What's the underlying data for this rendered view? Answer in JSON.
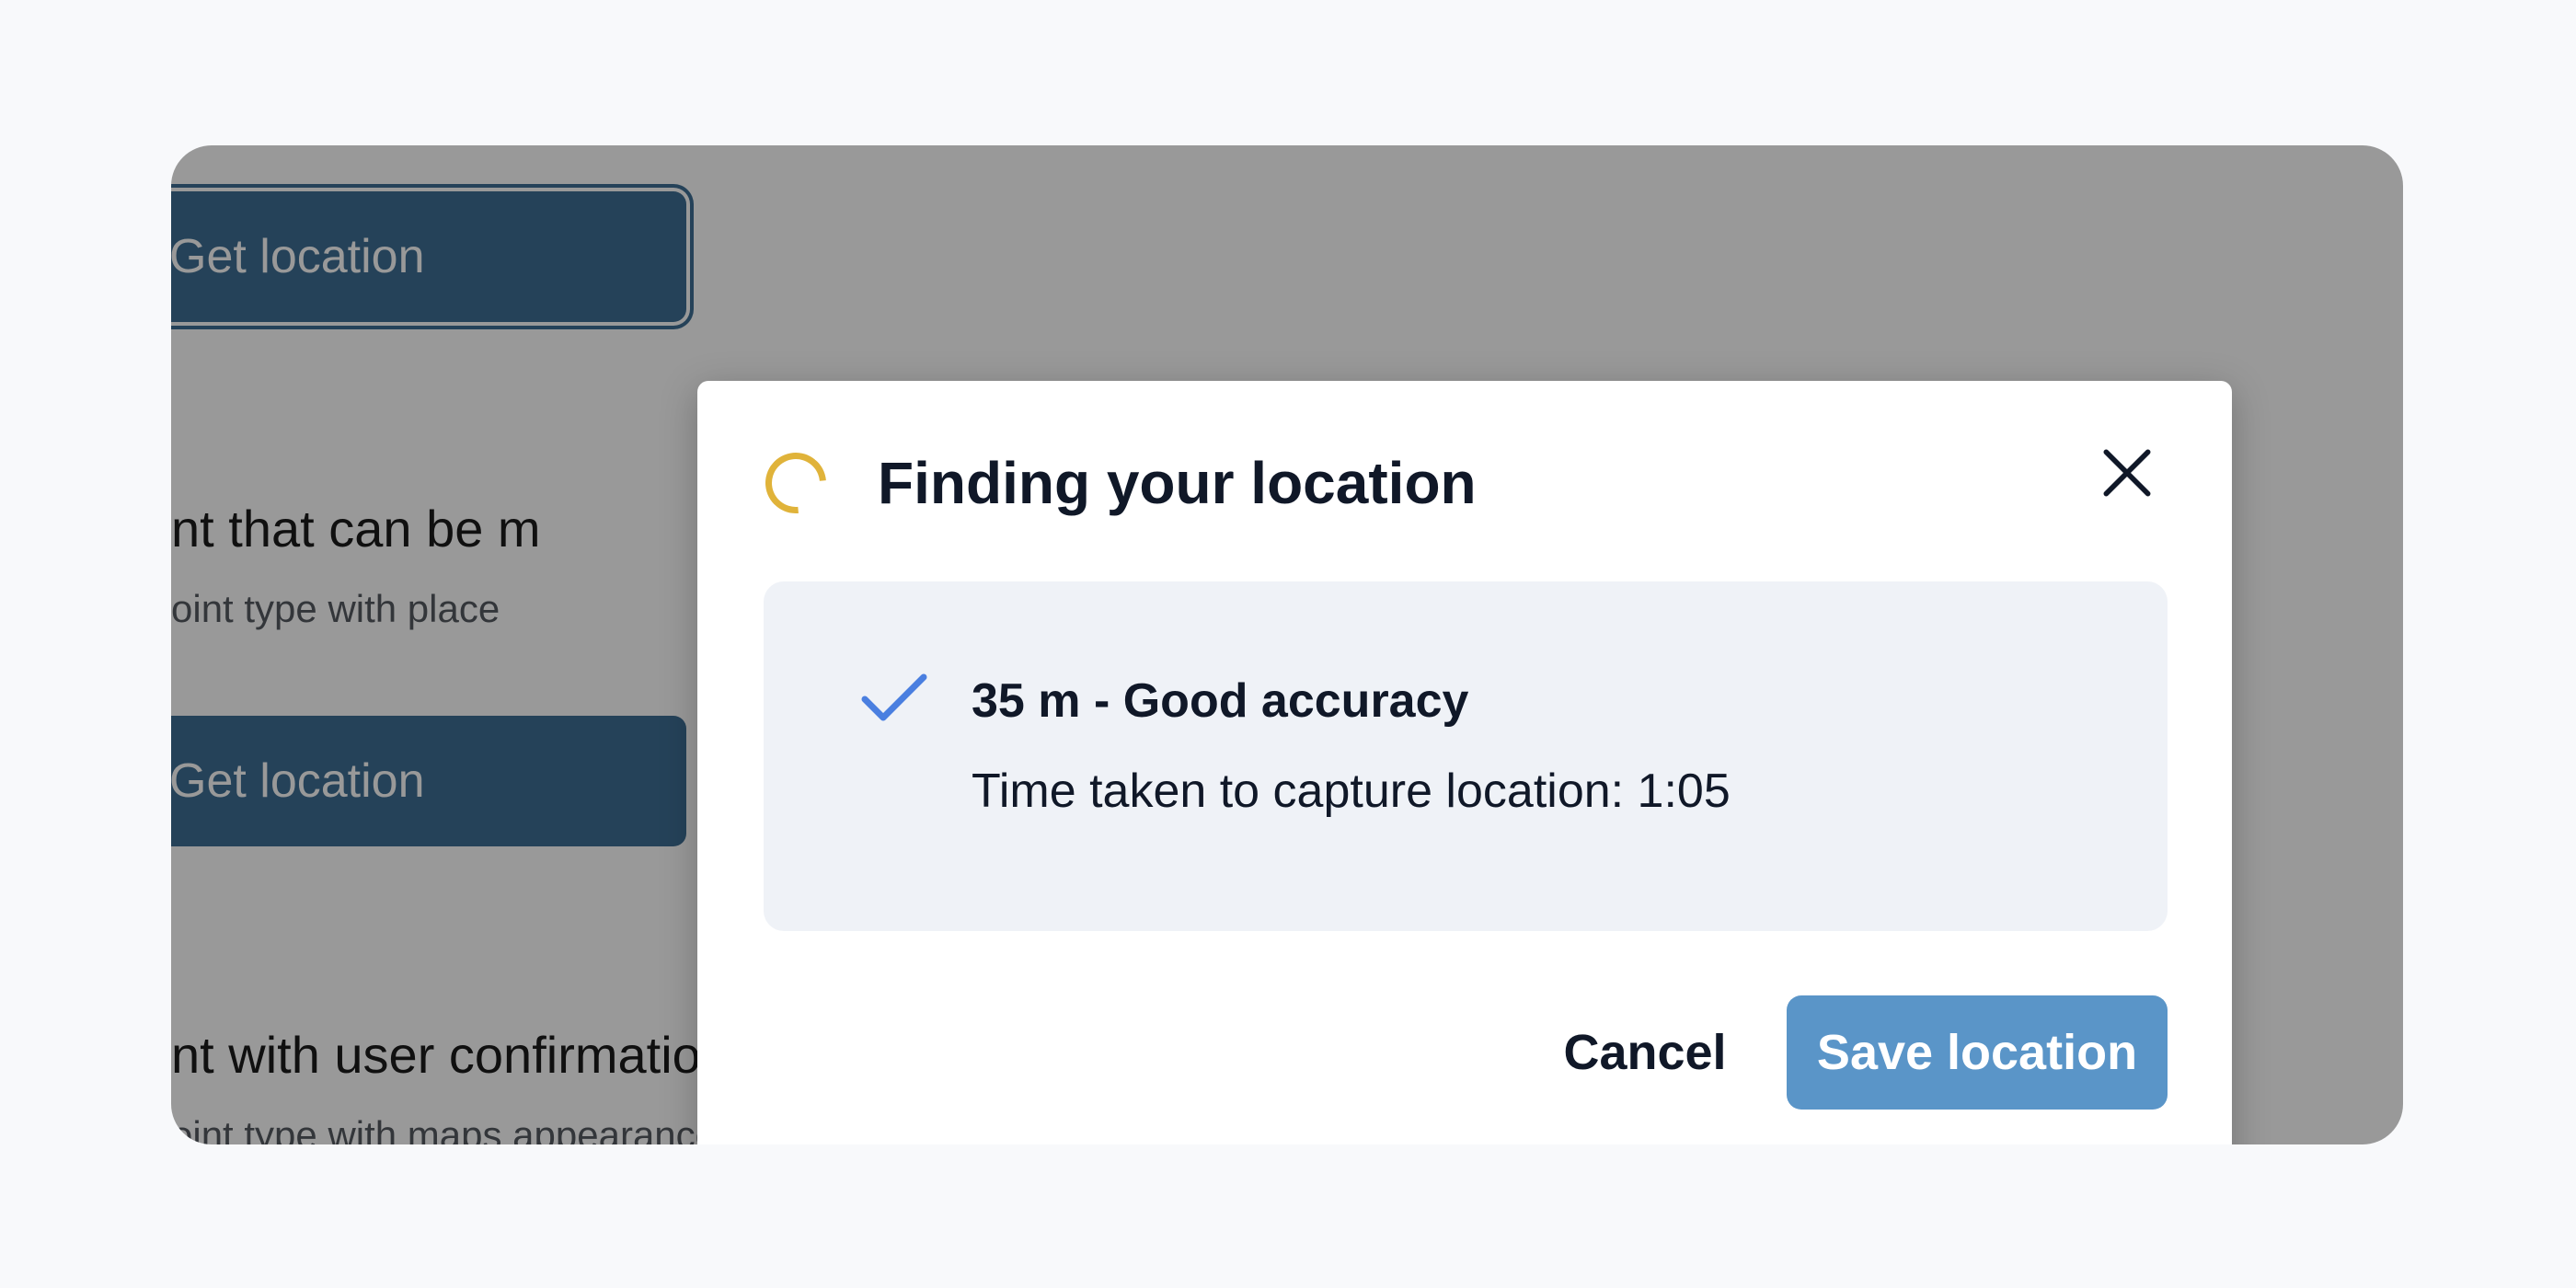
{
  "background": {
    "get_location_label_1": "Get location",
    "field_title_1": "nt that can be m",
    "field_hint_1": "oint type with place",
    "get_location_label_2": "Get location",
    "field_title_2": "nt with user confirmation on map",
    "field_hint_2": "oint type with maps appearance"
  },
  "dialog": {
    "title": "Finding your location",
    "spinner_icon": "loading-spinner",
    "close_icon": "close-x",
    "status": {
      "check_icon": "checkmark",
      "accuracy": "35 m - Good accuracy",
      "time_taken": "Time taken to capture location: 1:05"
    },
    "cancel_label": "Cancel",
    "save_label": "Save location"
  },
  "colors": {
    "primary": "#5a95c8",
    "spinner": "#e0b33a",
    "check": "#4a7fe0",
    "bg_button": "#3f6f94"
  }
}
